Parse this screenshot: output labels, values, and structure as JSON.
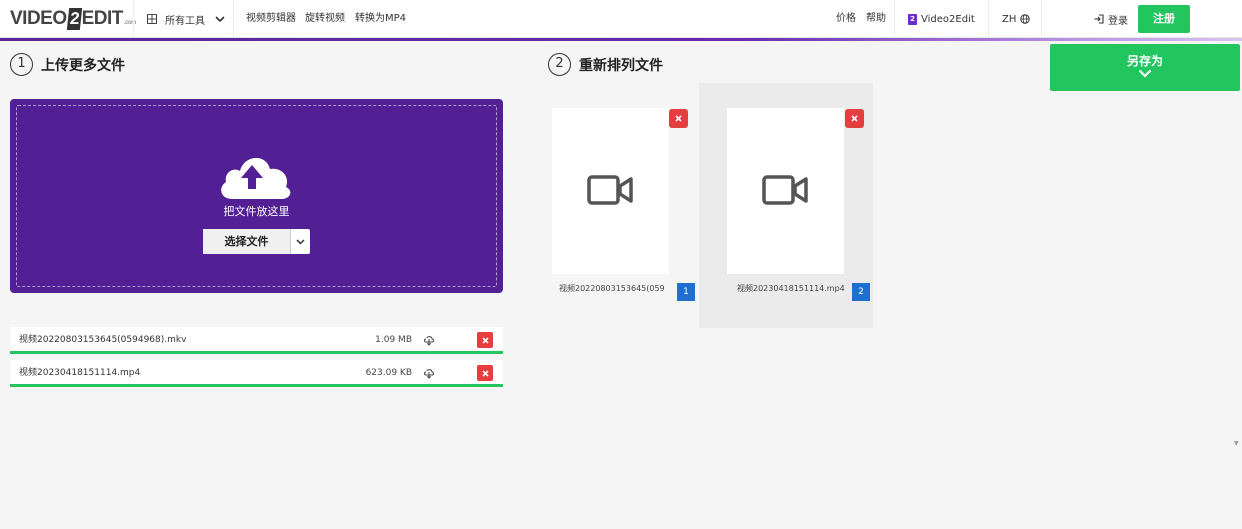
{
  "header": {
    "logo_text_1": "VIDEO",
    "logo_text_2": "2",
    "logo_text_3": "EDIT",
    "logo_text_4": ".com",
    "all_tools": "所有工具",
    "nav": [
      "视频剪辑器",
      "旋转视频",
      "转换为MP4"
    ],
    "price": "价格",
    "help": "帮助",
    "brand_badge": "2",
    "brand": "Video2Edit",
    "lang": "ZH",
    "login": "登录",
    "register": "注册"
  },
  "upload": {
    "step_number": "1",
    "title": "上传更多文件",
    "drop_text": "把文件放这里",
    "choose_button": "选择文件"
  },
  "reorder": {
    "step_number": "2",
    "title": "重新排列文件",
    "save_as": "另存为"
  },
  "files": [
    {
      "name": "视频20220803153645(0594968).mkv",
      "size": "1.09 MB",
      "card_name": "视频20220803153645(059...",
      "order": "1"
    },
    {
      "name": "视频20230418151114.mp4",
      "size": "623.09 KB",
      "card_name": "视频20230418151114.mp4",
      "order": "2"
    }
  ],
  "colors": {
    "accent_purple": "#521f94",
    "green": "#22c55e",
    "remove_red": "#e53e3e",
    "order_blue": "#1f6fd1"
  },
  "icons": [
    "grid-icon",
    "chevron-down-icon",
    "globe-icon",
    "login-icon",
    "cloud-upload-icon",
    "download-icon",
    "close-icon",
    "video-camera-icon"
  ]
}
